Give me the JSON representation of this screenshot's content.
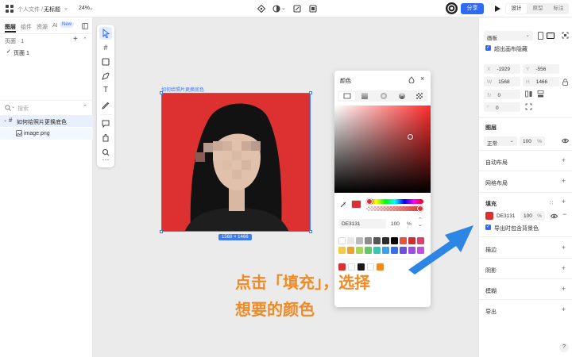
{
  "topbar": {
    "breadcrumb_root": "个人文件 /",
    "file_title": "无标题",
    "zoom": "24%",
    "share_label": "分享",
    "tab_design": "设计",
    "tab_prototype": "原型",
    "tab_annotate": "标注"
  },
  "left": {
    "tabs": [
      "图层",
      "组件",
      "资源",
      "AI"
    ],
    "ai_badge": "New",
    "pages_label": "页面 · 1",
    "page_item": "页面 1",
    "search_placeholder": "搜索",
    "frame_layer": "如何给照片更换底色",
    "image_layer": "image.png"
  },
  "canvas": {
    "frame_label": "如何给照片更换底色",
    "size_badge": "1568 × 1466",
    "frame_color": "#dd3131"
  },
  "color_picker": {
    "title": "颜色",
    "hex_value": "DE3131",
    "opacity": "100",
    "opacity_unit": "%",
    "swatches_row1": [
      "#ffffff",
      "#e8e8e8",
      "#b9b9b9",
      "#8c8c8c",
      "#555555",
      "#2b2b2b",
      "#000000",
      "#e8523a",
      "#c83030",
      "#e0406e"
    ],
    "swatches_row2": [
      "#f7c948",
      "#f2a12c",
      "#a8d65b",
      "#5fc96a",
      "#3cc4b0",
      "#3aa2e8",
      "#3a6fe8",
      "#6d4fe0",
      "#9b4fe0",
      "#c24fe0"
    ],
    "recent": [
      "#dd3131",
      "#ffffff",
      "#1a1a1a",
      "#ffffff",
      "#f08a24"
    ]
  },
  "right": {
    "frame_type": "画板",
    "clip_content": "超出画布隐藏",
    "x_label": "X",
    "x_value": "-1929",
    "y_label": "Y",
    "y_value": "-556",
    "w_label": "W",
    "w_value": "1568",
    "h_label": "H",
    "h_value": "1466",
    "rotation_value": "0",
    "radius_value": "0",
    "layer_title": "图层",
    "blend_mode": "正常",
    "layer_opacity": "100",
    "auto_layout": "自动布局",
    "grid_layout": "网格布局",
    "fill_title": "填充",
    "fill_hex": "DE3131",
    "fill_opacity": "100",
    "fill_color": "#dd3131",
    "export_bg": "导出时包含背景色",
    "stroke_title": "描边",
    "shadow_title": "阴影",
    "blur_title": "模糊",
    "export_title": "导出"
  },
  "annotation": {
    "line1": "点击「填充」，选择",
    "line2": "想要的颜色",
    "color": "#f08a24",
    "arrow_color": "#2d86e6"
  },
  "help_label": "?"
}
